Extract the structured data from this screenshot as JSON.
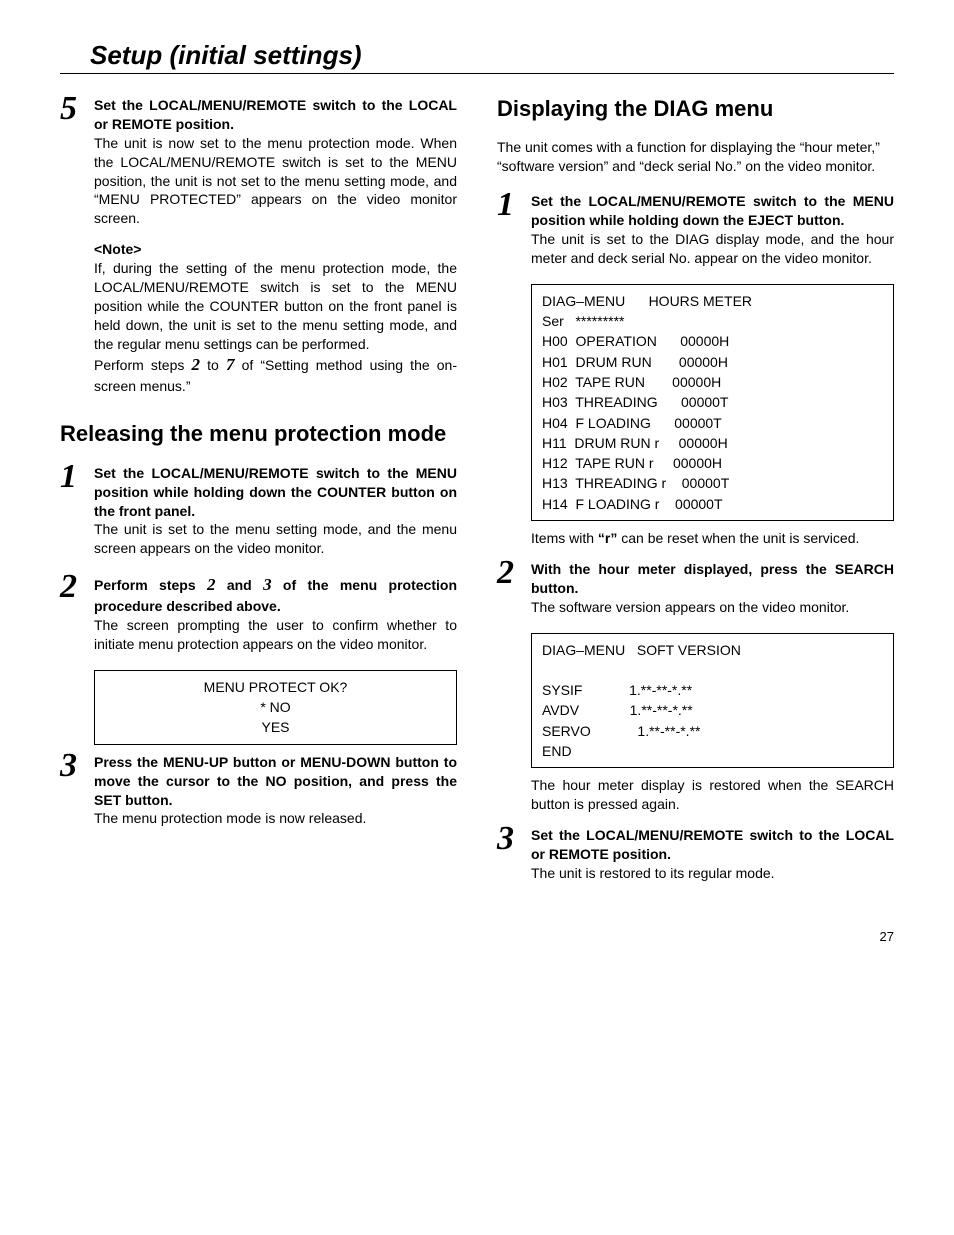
{
  "pageTitle": "Setup (initial settings)",
  "pageNumber": "27",
  "left": {
    "step5": {
      "head": "Set the LOCAL/MENU/REMOTE switch to the LOCAL or REMOTE position.",
      "body": "The unit is now set to the menu protection mode. When the LOCAL/MENU/REMOTE switch is set to the MENU position, the unit is not set to the menu setting mode, and “MENU PROTECTED” appears on the video monitor screen.",
      "noteHead": "<Note>",
      "noteBody": "If, during the setting of the menu protection mode, the LOCAL/MENU/REMOTE switch is set to the MENU position while the COUNTER button on the front panel is held down, the unit is set to the menu setting mode, and the regular menu settings can be performed.",
      "noteTail_a": "Perform steps ",
      "noteTail_b": " to ",
      "noteTail_c": " of “Setting method using the on-screen menus.”",
      "n2": "2",
      "n7": "7"
    },
    "h2": "Releasing the menu protection mode",
    "step1": {
      "head": "Set the LOCAL/MENU/REMOTE switch to the MENU position while holding down the COUNTER button on the front panel.",
      "body": "The unit is set to the menu setting mode, and the menu screen appears on the video monitor."
    },
    "step2": {
      "head_a": "Perform steps ",
      "head_b": " and ",
      "head_c": " of the menu protection procedure described above.",
      "n2": "2",
      "n3": "3",
      "body": "The screen prompting the user to confirm whether to initiate menu protection appears on the video monitor."
    },
    "box1": {
      "l1": "MENU PROTECT OK?",
      "l2": "*   NO",
      "l3": "YES"
    },
    "step3": {
      "head": "Press the MENU-UP button or MENU-DOWN button to move the cursor to the NO position, and press the SET button.",
      "body": "The menu protection mode is now released."
    }
  },
  "right": {
    "h2": "Displaying the DIAG menu",
    "intro": "The unit comes with a function for displaying the “hour meter,” “software version” and “deck serial No.” on the video monitor.",
    "step1": {
      "head": "Set the LOCAL/MENU/REMOTE switch to the MENU position while holding down the EJECT button.",
      "body": "The unit is set to the DIAG display mode, and the hour meter and deck serial No. appear on the video monitor."
    },
    "box1": "DIAG–MENU      HOURS METER\nSer   *********\nH00  OPERATION      00000H\nH01  DRUM RUN       00000H\nH02  TAPE RUN       00000H\nH03  THREADING      00000T\nH04  F LOADING      00000T\nH11  DRUM RUN r     00000H\nH12  TAPE RUN r     00000H\nH13  THREADING r    00000T\nH14  F LOADING r    00000T",
    "after1_a": "Items with ",
    "after1_b": "“r”",
    "after1_c": " can be reset when the unit is serviced.",
    "step2": {
      "head": "With the hour meter displayed, press the SEARCH button.",
      "body": "The software version appears on the video monitor."
    },
    "box2": "DIAG–MENU   SOFT VERSION\n\nSYSIF            1.**-**-*.**\nAVDV             1.**-**-*.**\nSERVO            1.**-**-*.**\nEND",
    "after2": "The hour meter display is restored when the SEARCH button is pressed again.",
    "step3": {
      "head": "Set the LOCAL/MENU/REMOTE switch to the LOCAL or REMOTE position.",
      "body": "The unit is restored to its regular mode."
    }
  }
}
